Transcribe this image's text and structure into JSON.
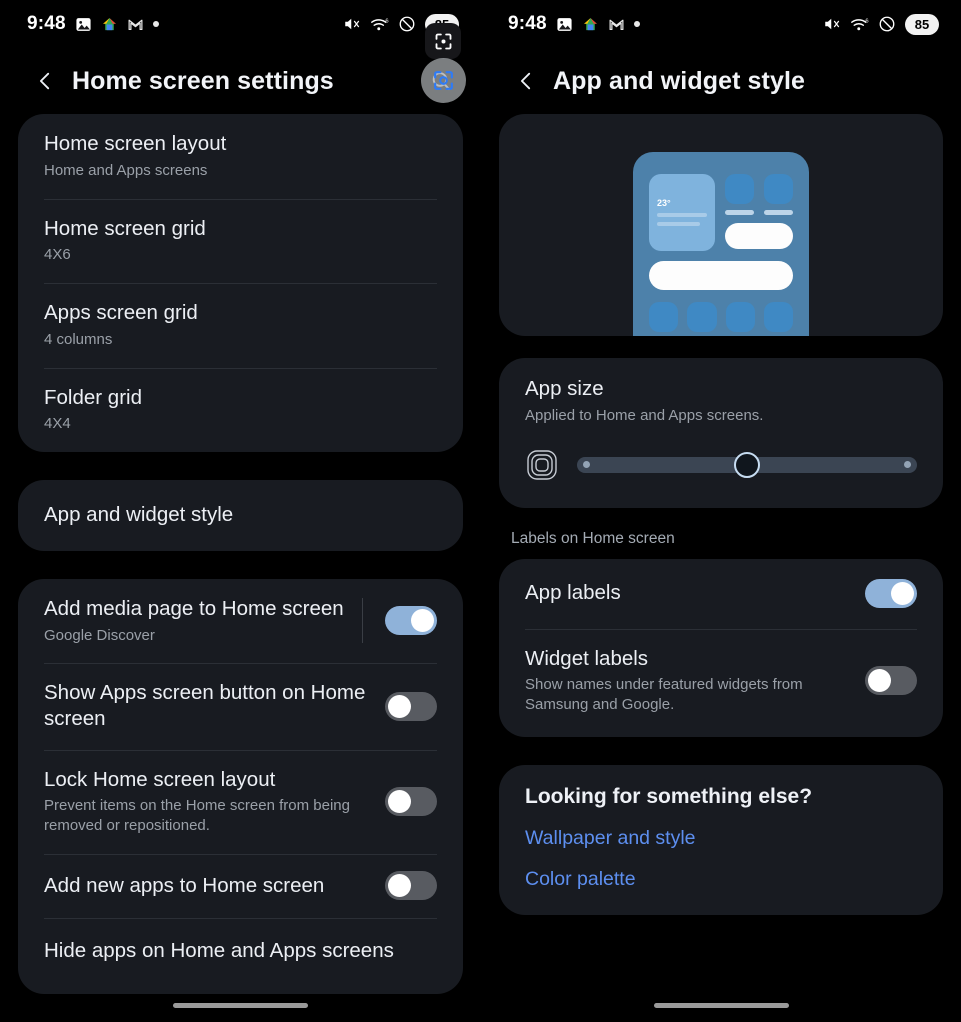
{
  "status_bar": {
    "time": "9:48",
    "left_icons": [
      "photos-icon",
      "google-home-icon",
      "gmail-icon",
      "dot-icon"
    ],
    "right_icons": [
      "mute-icon",
      "wifi6-icon",
      "do-not-disturb-icon"
    ],
    "battery": "85"
  },
  "overlay": {
    "crop_icon": "screenshot-crop-icon",
    "lens_icon": "google-lens-icon"
  },
  "left_screen": {
    "title": "Home screen settings",
    "back_icon": "back-chevron-icon",
    "search_icon": "search-icon",
    "group_grid": [
      {
        "title": "Home screen layout",
        "subtitle": "Home and Apps screens"
      },
      {
        "title": "Home screen grid",
        "subtitle": "4X6"
      },
      {
        "title": "Apps screen grid",
        "subtitle": "4 columns"
      },
      {
        "title": "Folder grid",
        "subtitle": "4X4"
      }
    ],
    "group_style": [
      {
        "title": "App and widget style"
      }
    ],
    "group_toggles": [
      {
        "title": "Add media page to Home screen",
        "subtitle": "Google Discover",
        "state": "on",
        "divider": true
      },
      {
        "title": "Show Apps screen button on Home screen",
        "subtitle": "",
        "state": "off",
        "divider": false
      },
      {
        "title": "Lock Home screen layout",
        "subtitle": "Prevent items on the Home screen from being removed or repositioned.",
        "state": "off",
        "divider": false
      },
      {
        "title": "Add new apps to Home screen",
        "subtitle": "",
        "state": "off",
        "divider": false
      }
    ],
    "last_row": {
      "title": "Hide apps on Home and Apps screens"
    }
  },
  "right_screen": {
    "title": "App and widget style",
    "back_icon": "back-chevron-icon",
    "preview": {
      "name": "home-screen-preview-illustration",
      "weather_temp": "23°"
    },
    "app_size": {
      "title": "App size",
      "subtitle": "Applied to Home and Apps screens.",
      "slider_icon": "app-size-icon",
      "slider_value": 50
    },
    "labels_section": "Labels on Home screen",
    "label_rows": [
      {
        "title": "App labels",
        "subtitle": "",
        "state": "on"
      },
      {
        "title": "Widget labels",
        "subtitle": "Show names under featured widgets from Samsung and Google.",
        "state": "off"
      }
    ],
    "links_card": {
      "heading": "Looking for something else?",
      "links": [
        "Wallpaper and style",
        "Color palette"
      ]
    }
  },
  "colors": {
    "card": "#181b21",
    "accent_on": "#8fb2d9",
    "link": "#5d8ff0",
    "phone_body": "#4d81aa"
  }
}
